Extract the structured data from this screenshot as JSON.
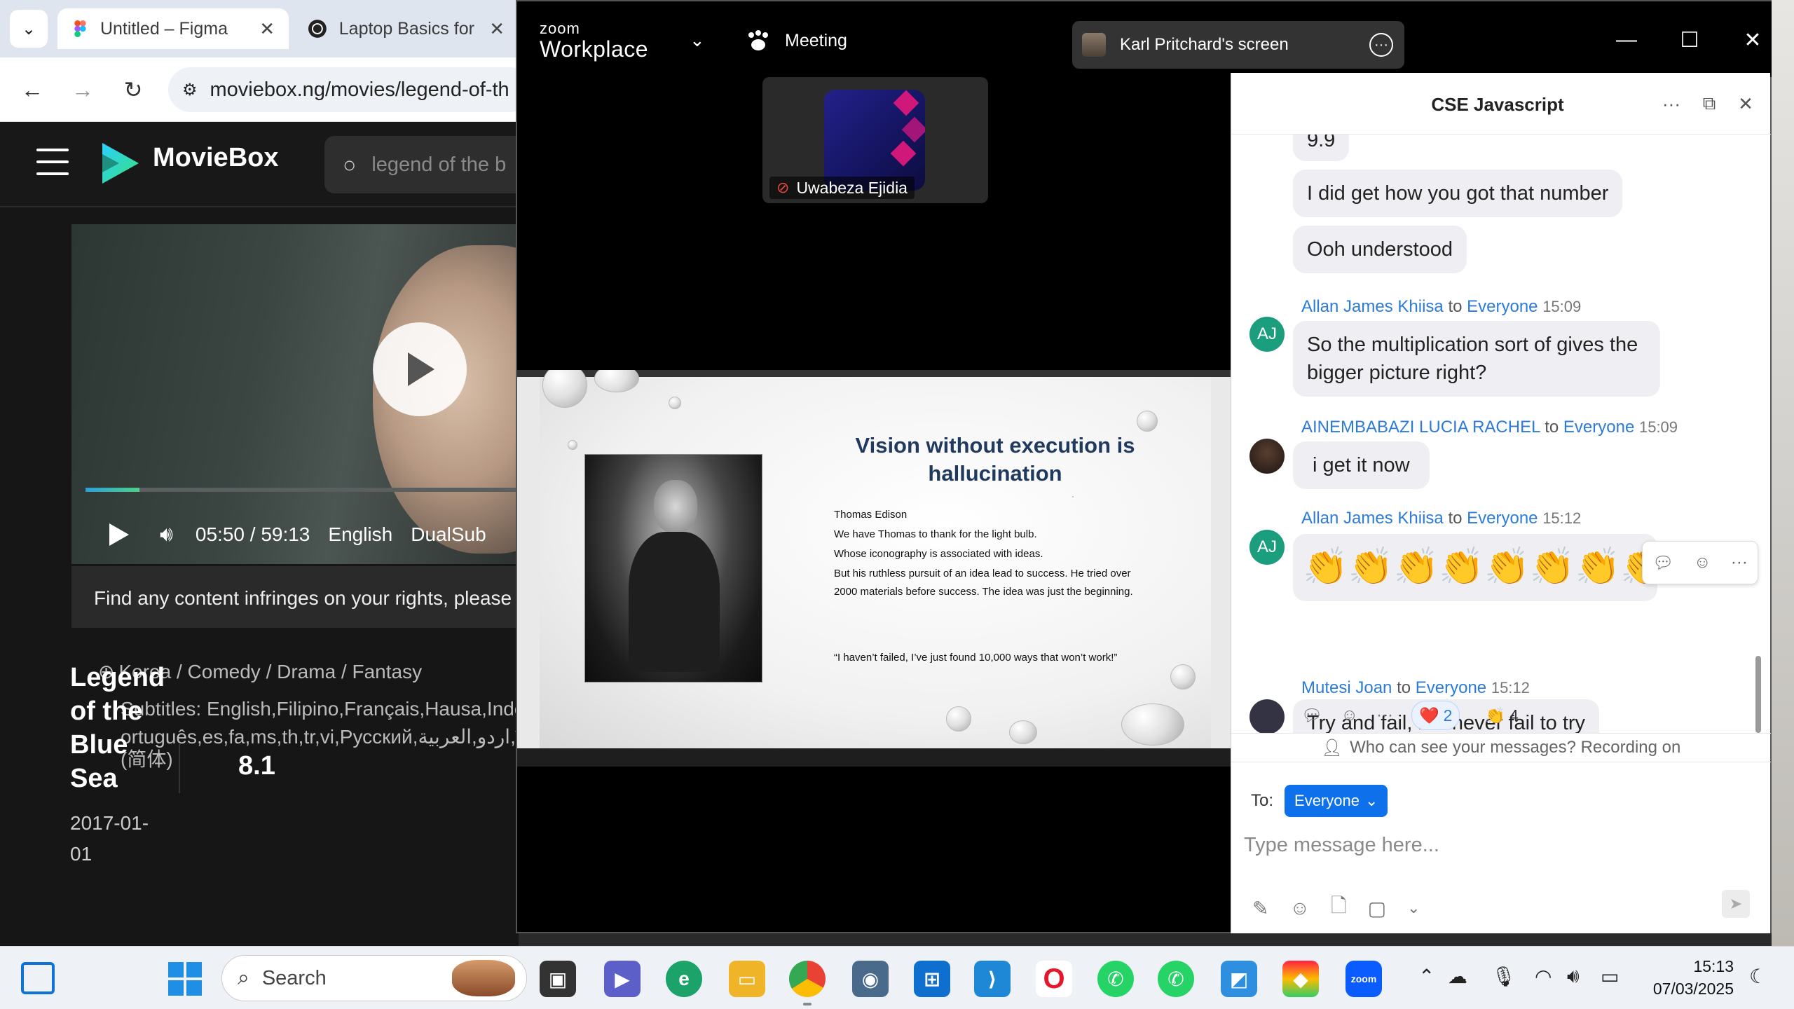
{
  "browser": {
    "tabs": [
      {
        "title": "Untitled – Figma",
        "icon": "figma-icon",
        "active": true
      },
      {
        "title": "Laptop Basics for E",
        "icon": "openai-icon",
        "active": false
      }
    ],
    "url": "moviebox.ng/movies/legend-of-th",
    "site": {
      "logo_text": "MovieBox",
      "search_placeholder": "legend of the b",
      "player": {
        "time": "05:50 / 59:13",
        "language": "English",
        "dualsub": "DualSub",
        "progress": 0.12
      },
      "notice": "Find any content infringes on your rights, please",
      "movie": {
        "title": "Legend of the Blue Sea",
        "genres": "Korea / Comedy / Drama / Fantasy",
        "subtitles_line1": "Subtitles: English,Filipino,Français,Hausa,Indon",
        "subtitles_line2": "ortuguês,es,fa,ms,th,tr,vi,Русский,اردو,العربية,ব",
        "subtitles_line3": "(简体)",
        "rating": "8.1",
        "date": "2017-01-01"
      }
    }
  },
  "zoom": {
    "logo_line1": "zoom",
    "logo_line2": "Workplace",
    "menu_label": "Meeting",
    "share_label": "Karl Pritchard's screen",
    "participant": {
      "name": "Uwabeza Ejidia",
      "muted": true
    },
    "slide": {
      "title": "Vision without execution is hallucination",
      "lines": [
        "Thomas Edison",
        "We have Thomas to thank for the light bulb.",
        "Whose iconography is associated with ideas.",
        "But his ruthless pursuit of an idea lead to success.  He tried over 2000 materials before success. The idea was just the beginning.",
        "“I haven’t failed, I’ve just found 10,000 ways that won’t work!”"
      ]
    },
    "chat": {
      "title": "CSE Javascript",
      "top_fragment": "9.9",
      "messages_self": [
        "I did get how you got that number",
        "Ooh understood"
      ],
      "messages": [
        {
          "sender": "Allan James Khiisa",
          "to": "to",
          "recipient": "Everyone",
          "time": "15:09",
          "initials": "AJ",
          "text": "So the multiplication sort of gives the bigger picture right?"
        },
        {
          "sender": "AINEMBABAZI LUCIA RACHEL",
          "to": "to",
          "recipient": "Everyone",
          "time": "15:09",
          "initials": "",
          "text": "i get it now"
        },
        {
          "sender": "Allan James Khiisa",
          "to": "to",
          "recipient": "Everyone",
          "time": "15:12",
          "initials": "AJ",
          "text": "👏👏👏👏👏👏👏👏"
        },
        {
          "sender": "Mutesi Joan",
          "to": "to",
          "recipient": "Everyone",
          "time": "15:12",
          "initials": "",
          "text": "Try and fail, but never fail to try"
        }
      ],
      "reactions": [
        {
          "emoji": "❤️",
          "count": "2"
        },
        {
          "emoji": "👏",
          "count": "4"
        }
      ],
      "privacy": "Who can see your messages? Recording on",
      "to_label": "To:",
      "to_value": "Everyone",
      "input_placeholder": "Type message here..."
    }
  },
  "taskbar": {
    "search_label": "Search",
    "time": "15:13",
    "date": "07/03/2025"
  },
  "colors": {
    "zoom_blue": "#0e71eb",
    "link_blue": "#2d7bd8",
    "avatar_green": "#1a9e7e"
  }
}
